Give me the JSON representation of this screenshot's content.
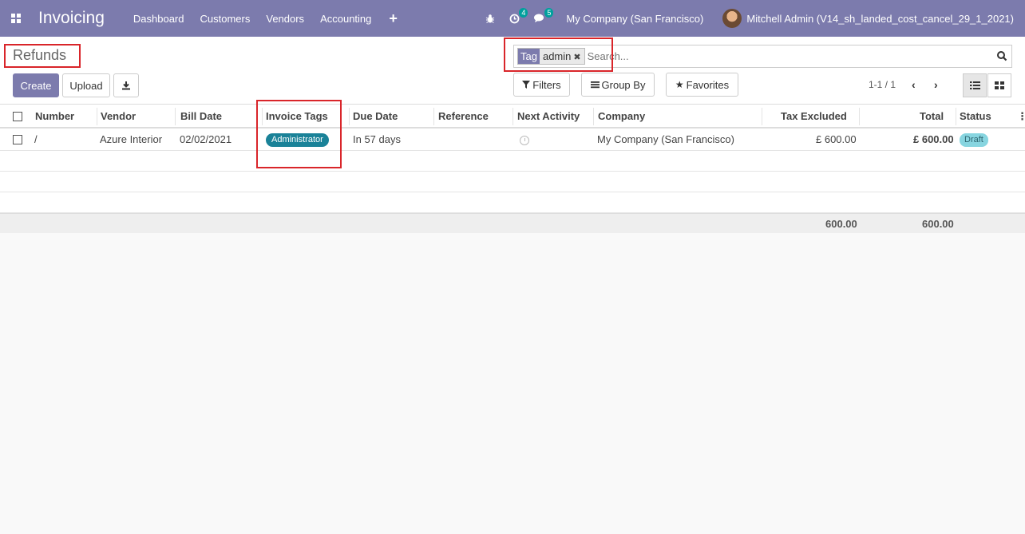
{
  "navbar": {
    "app_title": "Invoicing",
    "menu": [
      "Dashboard",
      "Customers",
      "Vendors",
      "Accounting"
    ],
    "plus": "+",
    "activity_count": "4",
    "message_count": "5",
    "company": "My Company (San Francisco)",
    "user": "Mitchell Admin (V14_sh_landed_cost_cancel_29_1_2021)"
  },
  "control": {
    "breadcrumb": "Refunds",
    "create_label": "Create",
    "upload_label": "Upload",
    "search": {
      "facet_category": "Tag",
      "facet_value": "admin",
      "placeholder": "Search..."
    },
    "filters_label": "Filters",
    "groupby_label": "Group By",
    "favorites_label": "Favorites",
    "pager": "1-1 / 1"
  },
  "table": {
    "columns": [
      "Number",
      "Vendor",
      "Bill Date",
      "Invoice Tags",
      "Due Date",
      "Reference",
      "Next Activity",
      "Company",
      "Tax Excluded",
      "Total",
      "Status"
    ],
    "rows": [
      {
        "number": "/",
        "vendor": "Azure Interior",
        "bill_date": "02/02/2021",
        "tag": "Administrator",
        "due_date": "In 57 days",
        "reference": "",
        "company": "My Company (San Francisco)",
        "tax_excluded": "£ 600.00",
        "total": "£ 600.00",
        "status": "Draft"
      }
    ],
    "footer": {
      "tax_excluded": "600.00",
      "total": "600.00"
    }
  },
  "colors": {
    "brand": "#7c7bad",
    "highlight": "#d9252a",
    "tag": "#1a8298",
    "status": "#87d5e0"
  }
}
